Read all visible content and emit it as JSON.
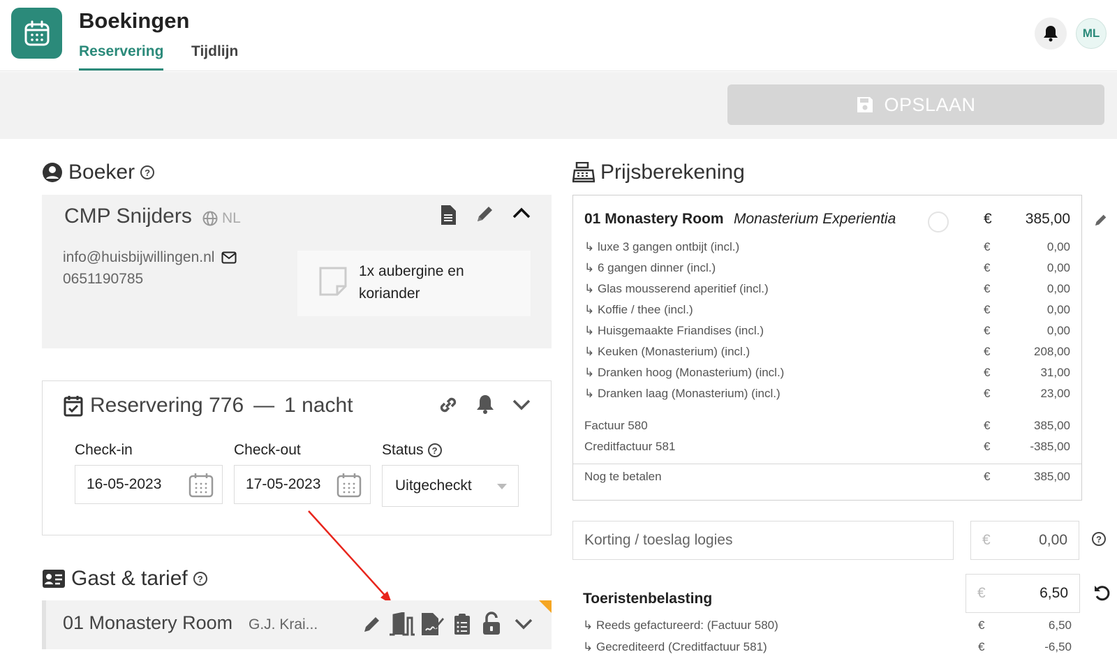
{
  "header": {
    "app_title": "Boekingen",
    "tabs": [
      "Reservering",
      "Tijdlijn"
    ],
    "avatar_initials": "ML",
    "accent_color": "#2b8a7a"
  },
  "toolbar": {
    "save_label": "OPSLAAN"
  },
  "boeker": {
    "title": "Boeker",
    "name": "CMP Snijders",
    "language": "NL",
    "email": "info@huisbijwillingen.nl",
    "phone": "0651190785",
    "note": "1x aubergine en koriander"
  },
  "reservering": {
    "title": "Reservering 776",
    "separator": "—",
    "nights": "1 nacht",
    "checkin_label": "Check-in",
    "checkin_value": "16-05-2023",
    "checkout_label": "Check-out",
    "checkout_value": "17-05-2023",
    "status_label": "Status",
    "status_value": "Uitgecheckt"
  },
  "gast": {
    "title": "Gast & tarief",
    "room": "01 Monastery Room",
    "guest": "G.J. Krai..."
  },
  "prijs": {
    "title": "Prijsberekening",
    "room_line": {
      "room": "01 Monastery Room",
      "arrangement": "Monasterium Experientia",
      "currency": "€",
      "amount": "385,00"
    },
    "items": [
      {
        "label": "luxe 3 gangen ontbijt  (incl.)",
        "currency": "€",
        "amount": "0,00"
      },
      {
        "label": "6 gangen dinner (incl.)",
        "currency": "€",
        "amount": "0,00"
      },
      {
        "label": "Glas mousserend aperitief (incl.)",
        "currency": "€",
        "amount": "0,00"
      },
      {
        "label": "Koffie / thee (incl.)",
        "currency": "€",
        "amount": "0,00"
      },
      {
        "label": "Huisgemaakte Friandises (incl.)",
        "currency": "€",
        "amount": "0,00"
      },
      {
        "label": "Keuken (Monasterium) (incl.)",
        "currency": "€",
        "amount": "208,00"
      },
      {
        "label": "Dranken hoog (Monasterium) (incl.)",
        "currency": "€",
        "amount": "31,00"
      },
      {
        "label": "Dranken laag (Monasterium) (incl.)",
        "currency": "€",
        "amount": "23,00"
      }
    ],
    "invoices": [
      {
        "label": "Factuur 580",
        "currency": "€",
        "amount": "385,00"
      },
      {
        "label": "Creditfactuur 581",
        "currency": "€",
        "amount": "-385,00"
      }
    ],
    "outstanding": {
      "label": "Nog te betalen",
      "currency": "€",
      "amount": "385,00"
    },
    "discount": {
      "placeholder": "Korting / toeslag logies",
      "currency": "€",
      "amount": "0,00"
    },
    "tourist_tax": {
      "label": "Toeristenbelasting",
      "currency": "€",
      "amount": "6,50",
      "lines": [
        {
          "label": "Reeds gefactureerd: (Factuur 580)",
          "currency": "€",
          "amount": "6,50"
        },
        {
          "label": "Gecrediteerd (Creditfactuur 581)",
          "currency": "€",
          "amount": "-6,50"
        }
      ]
    }
  }
}
